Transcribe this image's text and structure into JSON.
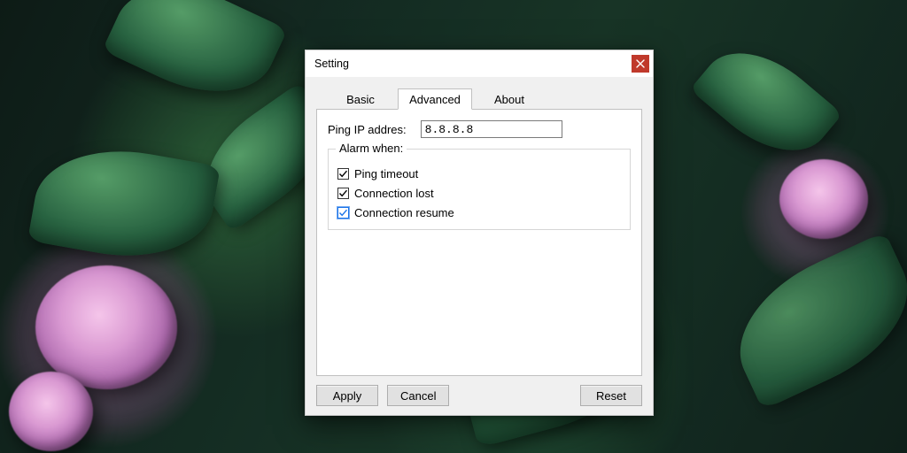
{
  "window": {
    "title": "Setting",
    "close_icon": "close-icon"
  },
  "tabs": {
    "basic": {
      "label": "Basic"
    },
    "advanced": {
      "label": "Advanced",
      "active": true
    },
    "about": {
      "label": "About"
    }
  },
  "form": {
    "ping_ip_label": "Ping IP addres:",
    "ping_ip_value": "8.8.8.8",
    "alarm_group_legend": "Alarm when:",
    "alarm": {
      "ping_timeout": {
        "label": "Ping timeout",
        "checked": true,
        "focused": false
      },
      "connection_lost": {
        "label": "Connection lost",
        "checked": true,
        "focused": false
      },
      "connection_resume": {
        "label": "Connection resume",
        "checked": true,
        "focused": true
      }
    }
  },
  "buttons": {
    "apply": "Apply",
    "cancel": "Cancel",
    "reset": "Reset"
  },
  "colors": {
    "close_bg": "#c0392b",
    "focus": "#1a73e8"
  }
}
